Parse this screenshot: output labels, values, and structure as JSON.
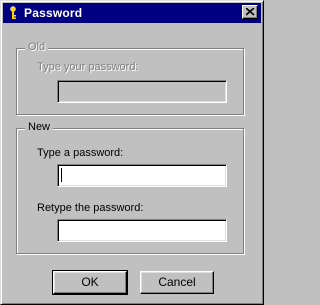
{
  "window": {
    "title": "Password",
    "icon": "key-icon",
    "close_icon": "close-icon"
  },
  "old_group": {
    "legend": "Old",
    "label": "Type your password:",
    "value": ""
  },
  "new_group": {
    "legend": "New",
    "type_label": "Type a password:",
    "type_value": "",
    "retype_label": "Retype the password:",
    "retype_value": ""
  },
  "buttons": {
    "ok": "OK",
    "cancel": "Cancel"
  }
}
